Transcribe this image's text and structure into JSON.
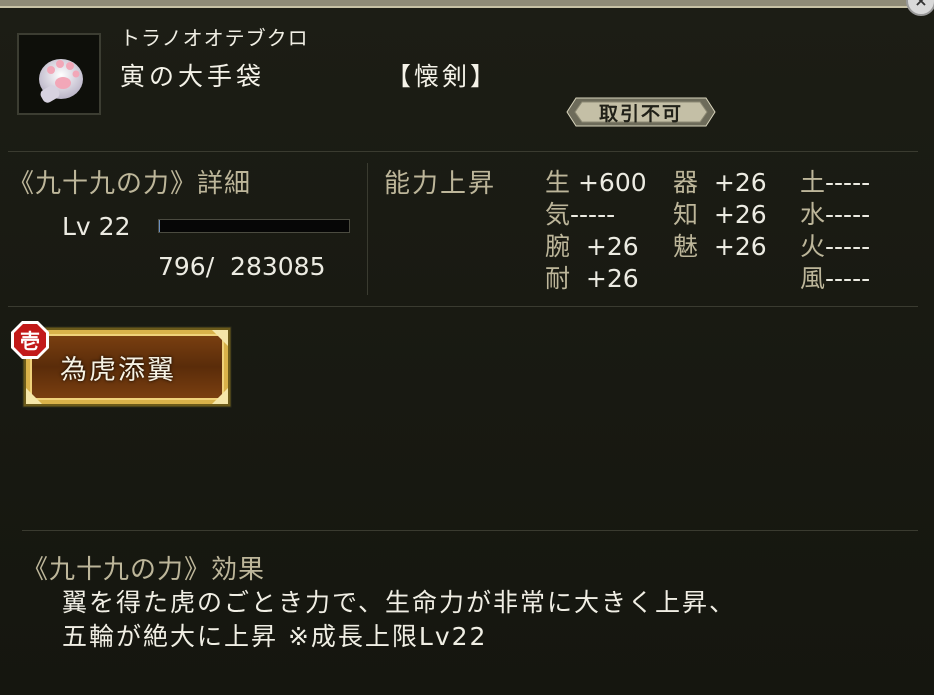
{
  "item": {
    "reading": "トラノオオテブクロ",
    "name": "寅の大手袋",
    "category": "【懐剣】",
    "trade_status": "取引不可",
    "icon": "paw-glove-icon"
  },
  "power": {
    "title": "《九十九の力》詳細",
    "level_label": "Lv 22",
    "exp_current": "796/",
    "exp_total": "283085",
    "exp_progress": 0.003
  },
  "abilities": {
    "title": "能力上昇",
    "col1": [
      {
        "key": "生",
        "value": " +600"
      },
      {
        "key": "気",
        "value": "-----"
      },
      {
        "key": "腕",
        "value": "  +26"
      },
      {
        "key": "耐",
        "value": "  +26"
      }
    ],
    "col2": [
      {
        "key": "器",
        "value": "  +26"
      },
      {
        "key": "知",
        "value": "  +26"
      },
      {
        "key": "魅",
        "value": "  +26"
      }
    ],
    "col3": [
      {
        "key": "土",
        "value": "-----"
      },
      {
        "key": "水",
        "value": "-----"
      },
      {
        "key": "火",
        "value": "-----"
      },
      {
        "key": "風",
        "value": "-----"
      }
    ]
  },
  "skill": {
    "badge": "壱",
    "label": "為虎添翼"
  },
  "effect": {
    "title": "《九十九の力》効果",
    "line1": "翼を得た虎のごとき力で、生命力が非常に大きく上昇、",
    "line2": "五輪が絶大に上昇 ※成長上限Lv22"
  },
  "colors": {
    "background": "#16170f",
    "heading": "#bdb69a",
    "text": "#ecebe2",
    "skill_gold": "#c9a23a",
    "badge_red": "#c21a1a"
  }
}
